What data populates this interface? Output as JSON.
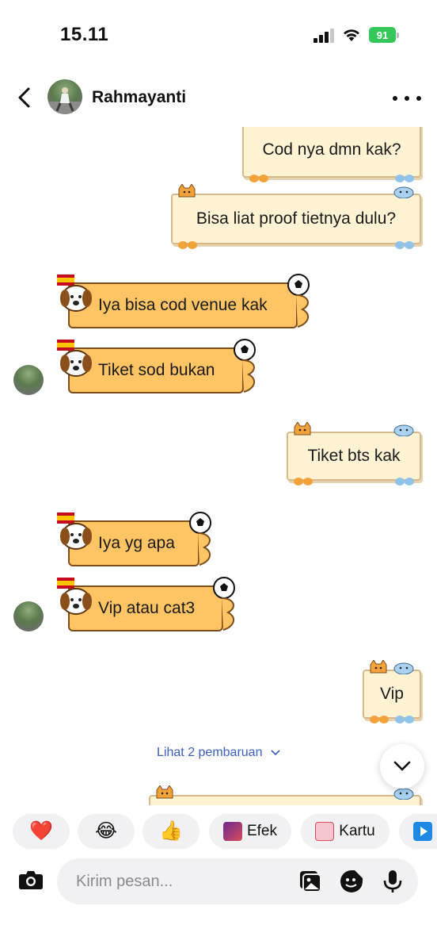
{
  "status_bar": {
    "time": "15.11",
    "battery": "91"
  },
  "header": {
    "contact_name": "Rahmayanti"
  },
  "messages": [
    {
      "side": "sent",
      "text": "Cod nya dmn kak?"
    },
    {
      "side": "sent",
      "text": "Bisa liat proof tietnya dulu?"
    },
    {
      "side": "received",
      "text": "Iya bisa cod venue kak"
    },
    {
      "side": "received",
      "text": "Tiket sod bukan"
    },
    {
      "side": "sent",
      "text": "Tiket bts kak"
    },
    {
      "side": "received",
      "text": "Iya yg apa"
    },
    {
      "side": "received",
      "text": "Vip atau cat3"
    },
    {
      "side": "sent",
      "text": "Vip"
    }
  ],
  "updates_link": "Lihat 2 pembaruan",
  "reactions": [
    {
      "label": "",
      "emoji": "❤️",
      "icon": "heart-emoji"
    },
    {
      "label": "",
      "emoji": "😂",
      "icon": "laughing-emoji"
    },
    {
      "label": "",
      "emoji": "👍",
      "icon": "thumbs-up-emoji"
    },
    {
      "label": "Efek",
      "icon": "effects-icon"
    },
    {
      "label": "Kartu",
      "icon": "card-icon"
    }
  ],
  "composer": {
    "placeholder": "Kirim pesan..."
  },
  "colors": {
    "received_bubble": "#ffc464",
    "sent_bubble": "#fff3d4",
    "battery": "#35c759",
    "link": "#3b5fc0"
  }
}
